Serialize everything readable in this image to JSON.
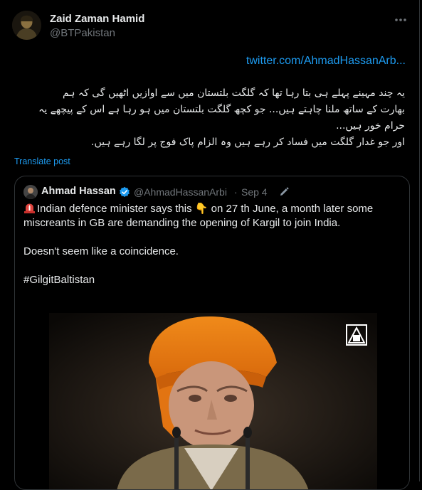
{
  "tweet": {
    "author_name": "Zaid Zaman Hamid",
    "author_handle": "@BTPakistan",
    "link_text": "twitter.com/AhmadHassanArb...",
    "urdu_lines": [
      "یہ چند مہینے پہلے ہی بتا رہا تھا کہ گلگت بلتستان میں سے اوازیں اٹھیں گی کہ ہم",
      "بھارت کے ساتھ ملنا چاہتے ہیں... جو کچھ گلگت بلتستان میں ہو رہا ہے اس کے پیچھے یہ",
      "حرام خور ہیں...",
      "اور جو غدار گلگت میں فساد کر رہے ہیں وہ الزام پاک فوج پر لگا رہے ہیں."
    ],
    "translate_label": "Translate post"
  },
  "quote": {
    "author_name": "Ahmad Hassan",
    "author_handle": "@AhmadHassanArbi",
    "separator": "·",
    "date": "Sep 4",
    "line1_pre": "Indian defence minister says this ",
    "line1_post": " on 27 th June, a month later some",
    "line2": "miscreants in GB are demanding the opening of Kargil to join India.",
    "line3": "Doesn't seem like a coincidence.",
    "hashtag": "#GilgitBaltistan",
    "emoji_pointing": "👇"
  },
  "icons": {
    "more": "more-icon",
    "verified": "verified-badge-icon",
    "edit": "edited-icon",
    "siren": "siren-icon",
    "watermark": "ani-logo"
  },
  "colors": {
    "background": "#000000",
    "link": "#1d9bf0",
    "secondary_text": "#71767b",
    "border": "#2f3336"
  }
}
